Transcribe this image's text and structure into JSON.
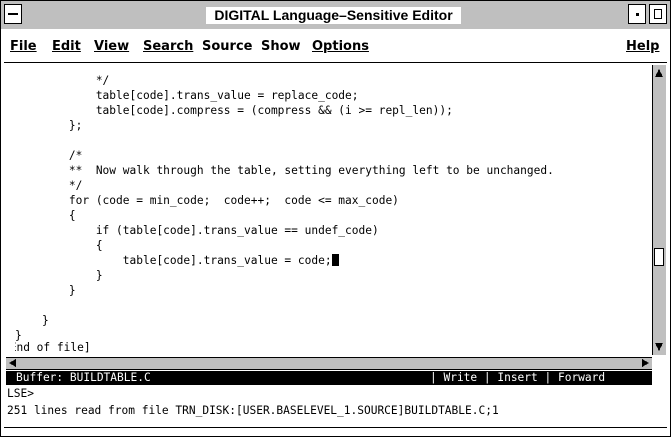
{
  "window": {
    "title": "DIGITAL Language–Sensitive Editor"
  },
  "menubar": {
    "items": [
      {
        "label": "File",
        "mnemonic": "F"
      },
      {
        "label": "Edit",
        "mnemonic": "E"
      },
      {
        "label": "View",
        "mnemonic": "V"
      },
      {
        "label": "Search",
        "mnemonic": "S"
      },
      {
        "label": "Source",
        "mnemonic": "u"
      },
      {
        "label": "Show",
        "mnemonic": "w"
      },
      {
        "label": "Options",
        "mnemonic": "O"
      }
    ],
    "help": "Help"
  },
  "editor": {
    "lines": [
      "            */",
      "            table[code].trans_value = replace_code;",
      "            table[code].compress = (compress && (i >= repl_len));",
      "        };",
      "",
      "        /*",
      "        **  Now walk through the table, setting everything left to be unchanged.",
      "        */",
      "        for (code = min_code;  code++;  code <= max_code)",
      "        {",
      "            if (table[code].trans_value == undef_code)",
      "            {",
      "                table[code].trans_value = code;",
      "            }",
      "        }",
      "",
      "    }",
      "}",
      "[End of file]"
    ]
  },
  "status": {
    "buffer": "Buffer: BUILDTABLE.C",
    "modes": "| Write | Insert | Forward"
  },
  "prompt": "LSE>",
  "message": "251 lines read from file TRN_DISK:[USER.BASELEVEL_1.SOURCE]BUILDTABLE.C;1"
}
